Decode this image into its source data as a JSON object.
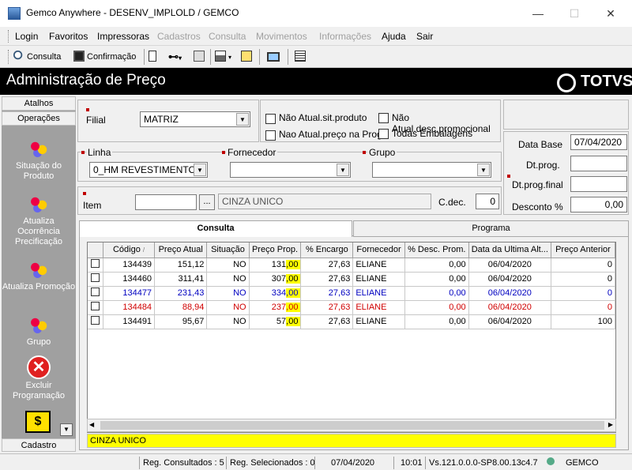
{
  "window": {
    "title": "Gemco Anywhere - DESENV_IMPLOLD / GEMCO",
    "min": "—",
    "max": "☐",
    "close": "✕"
  },
  "menu": [
    {
      "label": "Login",
      "enabled": true
    },
    {
      "label": "Favoritos",
      "enabled": true
    },
    {
      "label": "Impressoras",
      "enabled": true
    },
    {
      "label": "Cadastros",
      "enabled": false
    },
    {
      "label": "Consulta",
      "enabled": false
    },
    {
      "label": "Movimentos",
      "enabled": false
    },
    {
      "label": "Informações",
      "enabled": false
    },
    {
      "label": "Ajuda",
      "enabled": true
    },
    {
      "label": "Sair",
      "enabled": true
    }
  ],
  "toolbar": {
    "consulta": "Consulta",
    "confirmacao": "Confirmação"
  },
  "header": {
    "title": "Administração de Preço",
    "logo": "TOTVS"
  },
  "sidebar": {
    "atalhos": "Atalhos",
    "operacoes": "Operações",
    "items": [
      "Situação do Produto",
      "Atualiza Ocorrência Precificação",
      "Atualiza Promoção",
      "Grupo",
      "Excluir Programação"
    ],
    "cadastro": "Cadastro"
  },
  "filters": {
    "filial_label": "Filial",
    "filial_value": "MATRIZ",
    "chk1": "Não Atual.sit.produto",
    "chk2": "Nao Atual.preço na Progr.",
    "chk3": "Não Atual.desc.promocional",
    "chk4": "Todas Embalagens",
    "linha_label": "Linha",
    "linha_value": "0_HM REVESTIMENTO",
    "fornecedor_label": "Fornecedor",
    "grupo_label": "Grupo",
    "item_label": "Item",
    "item_btn": "...",
    "item_desc": "CINZA UNICO",
    "cdec_label": "C.dec.",
    "cdec_value": "0",
    "database_label": "Data Base",
    "database_value": "07/04/2020",
    "dtprog_label": "Dt.prog.",
    "dtprogfinal_label": "Dt.prog.final",
    "desconto_label": "Desconto %",
    "desconto_value": "0,00"
  },
  "tabs": {
    "consulta": "Consulta",
    "programa": "Programa"
  },
  "grid": {
    "columns": [
      "Código",
      "Preço Atual",
      "Situação",
      "Preço Prop.",
      "% Encargo",
      "Fornecedor",
      "% Desc. Prom.",
      "Data da Ultima Alt...",
      "Preço Anterior"
    ],
    "rows": [
      {
        "codigo": "134439",
        "preco_atual": "151,12",
        "situacao": "NO",
        "preco_prop_int": "131",
        "preco_prop_dec": ",00",
        "encargo": "27,63",
        "fornecedor": "ELIANE",
        "desc": "0,00",
        "data": "06/04/2020",
        "anterior": "0",
        "color": "#000000"
      },
      {
        "codigo": "134460",
        "preco_atual": "311,41",
        "situacao": "NO",
        "preco_prop_int": "307",
        "preco_prop_dec": ",00",
        "encargo": "27,63",
        "fornecedor": "ELIANE",
        "desc": "0,00",
        "data": "06/04/2020",
        "anterior": "0",
        "color": "#000000"
      },
      {
        "codigo": "134477",
        "preco_atual": "231,43",
        "situacao": "NO",
        "preco_prop_int": "334",
        "preco_prop_dec": ",00",
        "encargo": "27,63",
        "fornecedor": "ELIANE",
        "desc": "0,00",
        "data": "06/04/2020",
        "anterior": "0",
        "color": "#0000c0"
      },
      {
        "codigo": "134484",
        "preco_atual": "88,94",
        "situacao": "NO",
        "preco_prop_int": "237",
        "preco_prop_dec": ",00",
        "encargo": "27,63",
        "fornecedor": "ELIANE",
        "desc": "0,00",
        "data": "06/04/2020",
        "anterior": "0",
        "color": "#d00000"
      },
      {
        "codigo": "134491",
        "preco_atual": "95,67",
        "situacao": "NO",
        "preco_prop_int": "57",
        "preco_prop_dec": ",00",
        "encargo": "27,63",
        "fornecedor": "ELIANE",
        "desc": "0,00",
        "data": "06/04/2020",
        "anterior": "100",
        "color": "#000000"
      }
    ]
  },
  "footer_desc": "CINZA UNICO",
  "status": {
    "consultados": "Reg. Consultados : 5",
    "selecionados": "Reg. Selecionados : 0",
    "date": "07/04/2020",
    "time": "10:01",
    "version": "Vs.121.0.0.0-SP8.00.13c4.7",
    "user": "GEMCO"
  }
}
